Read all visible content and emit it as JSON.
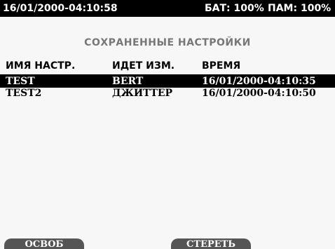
{
  "status_bar": {
    "datetime": "16/01/2000-04:10:58",
    "battery": "БАТ: 100%",
    "memory": "ПАМ: 100%"
  },
  "title": "СОХРАНЕННЫЕ НАСТРОЙКИ",
  "table": {
    "headers": {
      "name": "ИМЯ НАСТР.",
      "measurement": "ИДЕТ ИЗМ.",
      "time": "ВРЕМЯ"
    },
    "rows": [
      {
        "name": "TEST",
        "measurement": "BERT",
        "time": "16/01/2000-04:10:35",
        "selected": true
      },
      {
        "name": "TEST2",
        "measurement": "ДЖИТТЕР",
        "time": "16/01/2000-04:10:50",
        "selected": false
      }
    ]
  },
  "softkeys": {
    "key1": "ОСВОБ",
    "key3": "СТЕРЕТЬ"
  }
}
